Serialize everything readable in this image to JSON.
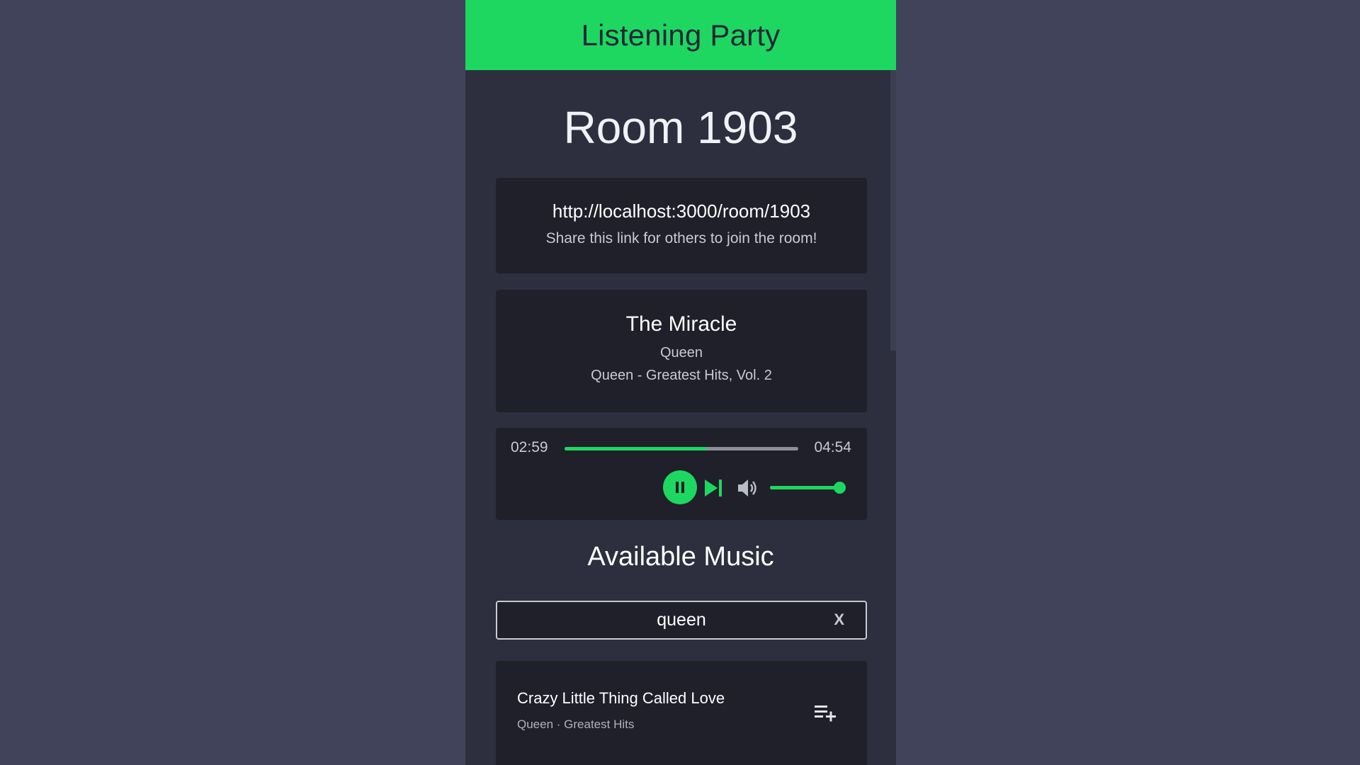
{
  "header": {
    "title": "Listening Party"
  },
  "room": {
    "title": "Room 1903"
  },
  "share": {
    "url": "http://localhost:3000/room/1903",
    "hint": "Share this link for others to join the room!"
  },
  "now_playing": {
    "title": "The Miracle",
    "artist": "Queen",
    "album": "Queen - Greatest Hits, Vol. 2"
  },
  "player": {
    "elapsed": "02:59",
    "total": "04:54",
    "progress_fraction": 0.609,
    "volume_fraction": 1.0,
    "play_icon": "pause-icon",
    "next_icon": "skip-next-icon",
    "volume_icon": "volume-icon"
  },
  "library": {
    "title": "Available Music",
    "search_value": "queen",
    "clear_label": "X",
    "results": [
      {
        "title": "Crazy Little Thing Called Love",
        "subtitle": "Queen · Greatest Hits",
        "action_icon": "playlist-add-icon"
      }
    ]
  },
  "colors": {
    "accent": "#1ed760",
    "page_background": "#40435a",
    "panel_background": "#2d2f3e",
    "card_background": "#1f2029"
  }
}
